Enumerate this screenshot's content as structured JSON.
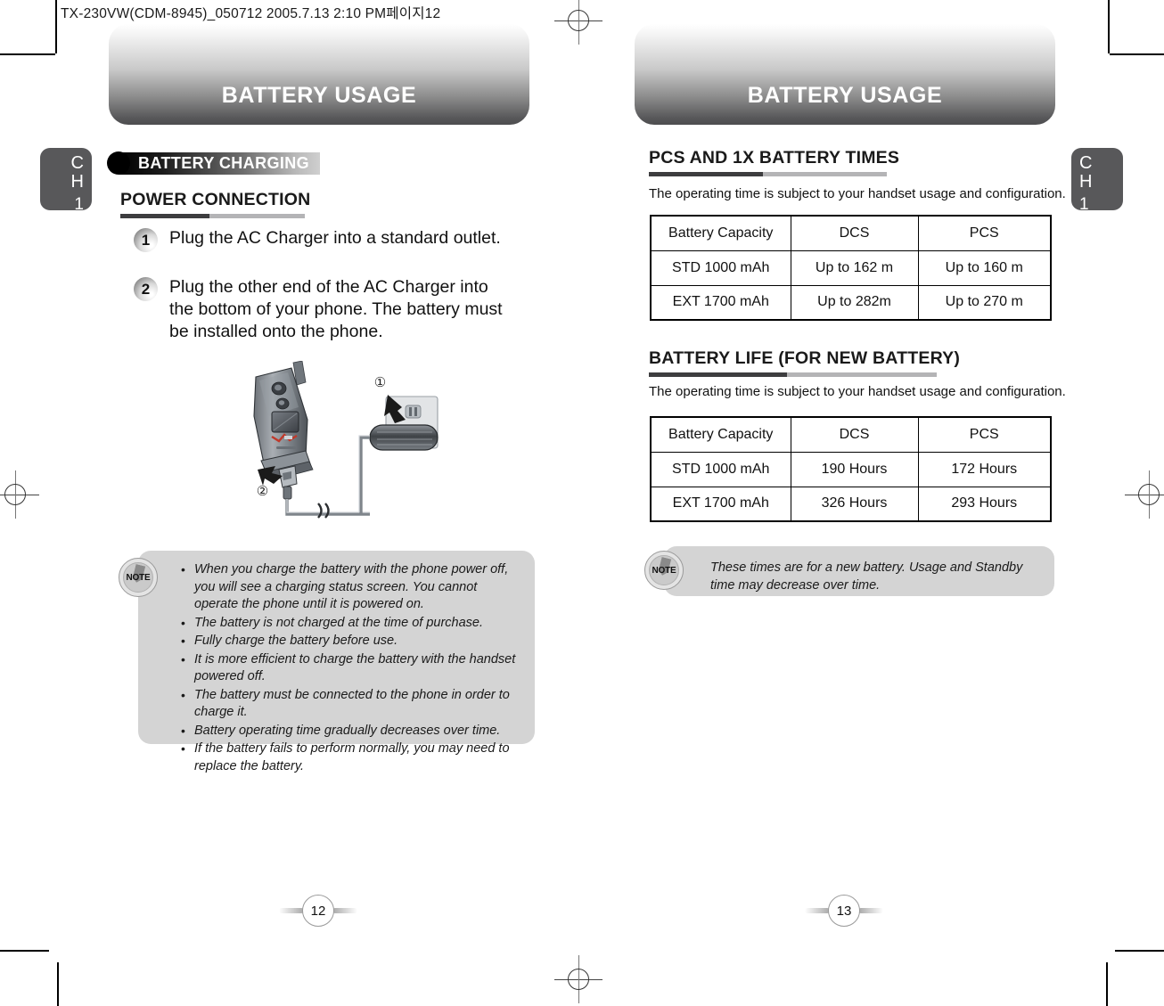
{
  "document": {
    "file_info": "TX-230VW(CDM-8945)_050712  2005.7.13 2:10 PM페이지12"
  },
  "left_page": {
    "banner_title": "BATTERY USAGE",
    "chapter_tab": {
      "ch_c": "C",
      "ch_h": "H",
      "number": "1"
    },
    "label_bar": "BATTERY CHARGING",
    "section_title": "POWER CONNECTION",
    "steps": [
      {
        "number": "1",
        "text": "Plug the AC Charger into a standard outlet."
      },
      {
        "number": "2",
        "text": "Plug the other end of the AC Charger into the bottom of your phone. The battery must be installed onto the phone."
      }
    ],
    "illustration": {
      "callout_1": "①",
      "callout_2": "②"
    },
    "note": {
      "icon_label": "NOTE",
      "items": [
        "When you charge the battery with the phone power off, you will see a charging status screen. You cannot operate the phone until it is powered on.",
        "The battery is not charged at the time of purchase.",
        "Fully charge the battery before use.",
        "It is more efficient to charge the battery with the handset powered off.",
        "The battery must be connected to the phone in order to charge it.",
        "Battery operating time gradually decreases over time.",
        "If the battery fails to perform normally, you may need to replace the battery."
      ]
    },
    "page_number": "12"
  },
  "right_page": {
    "banner_title": "BATTERY USAGE",
    "chapter_tab": {
      "ch_c": "C",
      "ch_h": "H",
      "number": "1"
    },
    "section_1": {
      "title": "PCS AND 1X BATTERY TIMES",
      "intro": "The operating time is subject to your handset usage and configuration.",
      "table": {
        "headers": [
          "Battery Capacity",
          "DCS",
          "PCS"
        ],
        "rows": [
          [
            "STD 1000 mAh",
            "Up to 162 m",
            "Up to 160 m"
          ],
          [
            "EXT 1700 mAh",
            "Up to 282m",
            "Up to 270 m"
          ]
        ]
      }
    },
    "section_2": {
      "title": "BATTERY LIFE (FOR NEW BATTERY)",
      "intro": "The operating time is subject to your handset usage and configuration.",
      "table": {
        "headers": [
          "Battery Capacity",
          "DCS",
          "PCS"
        ],
        "rows": [
          [
            "STD 1000 mAh",
            "190 Hours",
            "172 Hours"
          ],
          [
            "EXT 1700 mAh",
            "326 Hours",
            "293 Hours"
          ]
        ]
      }
    },
    "note": {
      "icon_label": "NOTE",
      "text": "These times are for a new battery. Usage and Standby time may decrease over time."
    },
    "page_number": "13"
  },
  "colors": {
    "banner_dark": "#4d4d4f",
    "tab_gray": "#58585a",
    "note_bg": "#d4d4d4",
    "rule_dark": "#3d3d3f",
    "rule_light": "#b4b4b6"
  }
}
